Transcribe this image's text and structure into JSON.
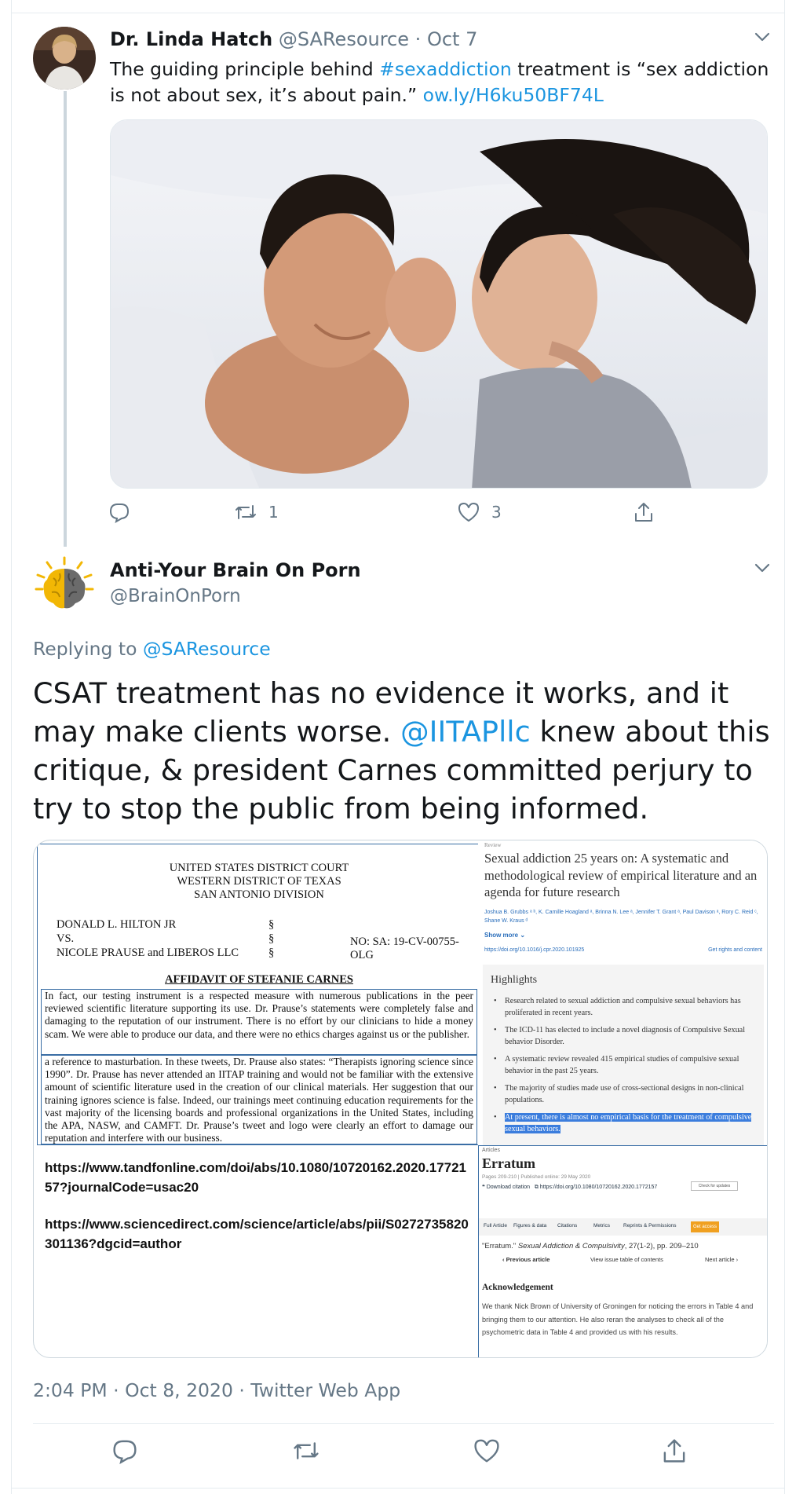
{
  "tweet1": {
    "name": "Dr. Linda Hatch",
    "handle": "@SAResource",
    "separator": "·",
    "date": "Oct 7",
    "text_before": "The guiding principle behind ",
    "hashtag": "#sexaddiction",
    "text_after": " treatment is “sex addiction is not about sex, it’s about pain.” ",
    "link": "ow.ly/H6ku50BF74L",
    "retweet_count": "1",
    "like_count": "3"
  },
  "tweet2": {
    "name": "Anti-Your Brain On Porn",
    "handle": "@BrainOnPorn",
    "replying_prefix": "Replying to ",
    "replying_handle": "@SAResource",
    "text_part1": "CSAT treatment has no evidence it works, and it may make clients worse. ",
    "mention": "@IITAPllc",
    "text_part2": " knew about this critique, & president Carnes committed perjury to try to stop the public from being informed.",
    "timestamp": "2:04 PM · Oct 8, 2020 · Twitter Web App"
  },
  "court_doc": {
    "header_line1": "UNITED STATES DISTRICT COURT",
    "header_line2": "WESTERN DISTRICT OF TEXAS",
    "header_line3": "SAN ANTONIO DIVISION",
    "party1": "DONALD L. HILTON JR",
    "party_vs": "VS.",
    "party2": "NICOLE PRAUSE and LIBEROS LLC",
    "section_mark": "§",
    "case_no": "NO:   SA: 19-CV-00755-OLG",
    "title": "AFFIDAVIT OF STEFANIE CARNES",
    "para1": "In fact, our testing instrument is a respected measure with numerous publications in the peer reviewed scientific literature supporting its use.  Dr. Prause’s statements were completely false and damaging to the reputation of our instrument.  There is no effort by our clinicians to hide a money scam.  We were able to produce our data, and there were no ethics charges against us or the publisher.",
    "para2": "a reference to masturbation.  In these tweets, Dr. Prause also states: “Therapists ignoring science since 1990”.  Dr. Prause has never attended an IITAP training and would not be familiar with the extensive amount of scientific literature used in the creation of our clinical materials.  Her suggestion that our training ignores science is false.  Indeed, our trainings meet continuing education requirements for the vast majority of the licensing boards and professional organizations in the United States, including the APA, NASW, and CAMFT.  Dr. Prause’s tweet and logo were clearly an effort to damage our reputation and interfere with our business.",
    "url1": "https://www.tandfonline.com/doi/abs/10.1080/10720162.2020.1772157?journalCode=usac20",
    "url2": "https://www.sciencedirect.com/science/article/abs/pii/S0272735820301136?dgcid=author"
  },
  "article": {
    "kicker": "Review",
    "title": "Sexual addiction 25 years on: A systematic and methodological review of empirical literature and an agenda for future research",
    "authors": "Joshua B. Grubbs ᵃ ᵇ, K. Camille Hoagland ᵃ, Brinna N. Lee ᵃ, Jennifer T. Grant ᵃ, Paul Davison ᵃ, Rory C. Reid ᶜ, Shane W. Kraus ᵈ",
    "show_more": "Show more",
    "doi": "https://doi.org/10.1016/j.cpr.2020.101925",
    "rights": "Get rights and content",
    "highlights_title": "Highlights",
    "highlights": [
      "Research related to sexual addiction and compulsive sexual behaviors has proliferated in recent years.",
      "The ICD-11 has elected to include a novel diagnosis of Compulsive Sexual behavior Disorder.",
      "A systematic review revealed 415 empirical studies of compulsive sexual behavior in the past 25 years.",
      "The majority of studies made use of cross-sectional designs in non-clinical populations."
    ],
    "highlight_selected": "At present, there is almost no empirical basis for the treatment of compulsive sexual behaviors."
  },
  "erratum": {
    "kicker": "Articles",
    "title": "Erratum",
    "pages": "Pages 209-210 | Published online: 29 May 2020",
    "download": "Download citation",
    "doi": "https://doi.org/10.1080/10720162.2020.1772157",
    "check_updates": "Check for updates",
    "tabs": [
      "Full Article",
      "Figures & data",
      "Citations",
      "Metrics",
      "Reprints & Permissions"
    ],
    "access": "Get access",
    "citation_quote": "\"Erratum.\" ",
    "citation_journal": "Sexual Addiction & Compulsivity",
    "citation_rest": ", 27(1-2), pp. 209–210",
    "prev": "Previous article",
    "toc": "View issue table of contents",
    "next": "Next article",
    "ack_title": "Acknowledgement",
    "ack_text": "We thank Nick Brown of University of Groningen for noticing the errors in Table 4 and bringing them to our attention. He also reran the analyses to check all of the psychometric data in Table 4 and provided us with his results."
  },
  "icons": {
    "reply": "reply-icon",
    "retweet": "retweet-icon",
    "like": "heart-icon",
    "share": "share-icon",
    "caret": "chevron-down-icon"
  },
  "colors": {
    "link": "#1b95e0",
    "secondary_text": "#657786",
    "border": "#e6ecf0",
    "thread": "#ccd6dd"
  }
}
